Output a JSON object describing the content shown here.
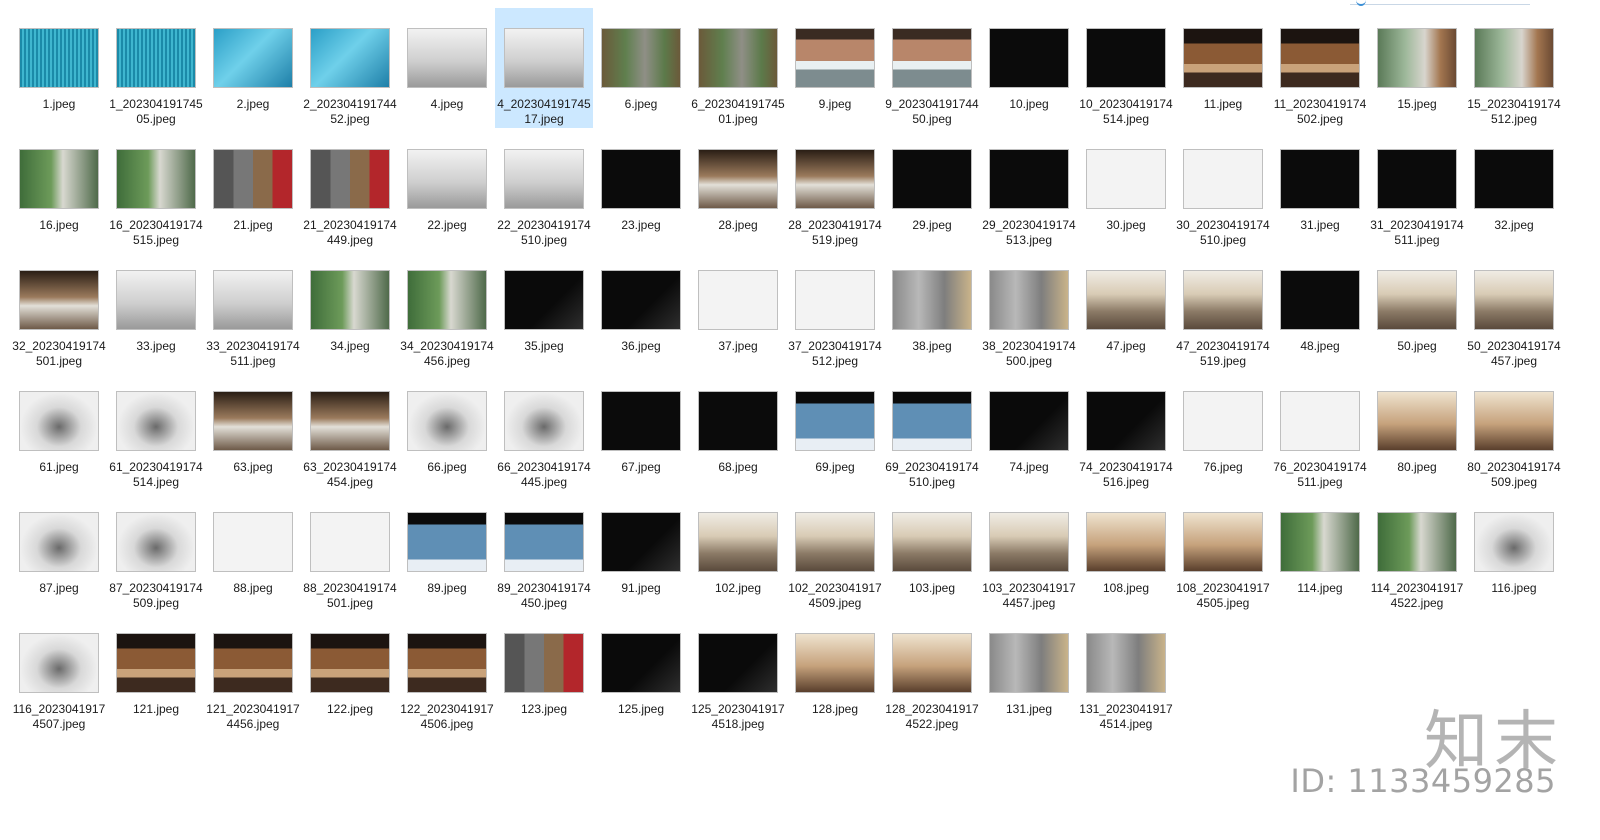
{
  "watermark": {
    "logo_text": "知末",
    "id_text": "ID: 1133459285"
  },
  "items": [
    {
      "label": "1.jpeg",
      "style": "t-teal"
    },
    {
      "label": "1_20230419174505.jpeg",
      "style": "t-teal"
    },
    {
      "label": "2.jpeg",
      "style": "t-teal2"
    },
    {
      "label": "2_20230419174452.jpeg",
      "style": "t-teal2"
    },
    {
      "label": "4.jpeg",
      "style": "t-gray"
    },
    {
      "label": "4_20230419174517.jpeg",
      "style": "t-gray",
      "selected": true
    },
    {
      "label": "6.jpeg",
      "style": "t-plan"
    },
    {
      "label": "6_20230419174501.jpeg",
      "style": "t-plan"
    },
    {
      "label": "9.jpeg",
      "style": "t-warm"
    },
    {
      "label": "9_20230419174450.jpeg",
      "style": "t-warm"
    },
    {
      "label": "10.jpeg",
      "style": "t-black"
    },
    {
      "label": "10_20230419174514.jpeg",
      "style": "t-black"
    },
    {
      "label": "11.jpeg",
      "style": "t-wood"
    },
    {
      "label": "11_20230419174502.jpeg",
      "style": "t-wood"
    },
    {
      "label": "15.jpeg",
      "style": "t-glass"
    },
    {
      "label": "15_20230419174512.jpeg",
      "style": "t-glass"
    },
    {
      "label": "16.jpeg",
      "style": "t-green"
    },
    {
      "label": "16_20230419174515.jpeg",
      "style": "t-green"
    },
    {
      "label": "21.jpeg",
      "style": "t-mat"
    },
    {
      "label": "21_20230419174449.jpeg",
      "style": "t-mat"
    },
    {
      "label": "22.jpeg",
      "style": "t-gray"
    },
    {
      "label": "22_20230419174510.jpeg",
      "style": "t-gray"
    },
    {
      "label": "23.jpeg",
      "style": "t-black"
    },
    {
      "label": "28.jpeg",
      "style": "t-retail"
    },
    {
      "label": "28_20230419174519.jpeg",
      "style": "t-retail"
    },
    {
      "label": "29.jpeg",
      "style": "t-black"
    },
    {
      "label": "29_20230419174513.jpeg",
      "style": "t-black"
    },
    {
      "label": "30.jpeg",
      "style": "t-white"
    },
    {
      "label": "30_20230419174510.jpeg",
      "style": "t-white"
    },
    {
      "label": "31.jpeg",
      "style": "t-black"
    },
    {
      "label": "31_20230419174511.jpeg",
      "style": "t-black"
    },
    {
      "label": "32.jpeg",
      "style": "t-black"
    },
    {
      "label": "32_20230419174501.jpeg",
      "style": "t-retail"
    },
    {
      "label": "33.jpeg",
      "style": "t-gray"
    },
    {
      "label": "33_20230419174511.jpeg",
      "style": "t-gray"
    },
    {
      "label": "34.jpeg",
      "style": "t-green"
    },
    {
      "label": "34_20230419174456.jpeg",
      "style": "t-green"
    },
    {
      "label": "35.jpeg",
      "style": "t-dark2"
    },
    {
      "label": "36.jpeg",
      "style": "t-dark2"
    },
    {
      "label": "37.jpeg",
      "style": "t-white"
    },
    {
      "label": "37_20230419174512.jpeg",
      "style": "t-white"
    },
    {
      "label": "38.jpeg",
      "style": "t-stone"
    },
    {
      "label": "38_20230419174500.jpeg",
      "style": "t-stone"
    },
    {
      "label": "47.jpeg",
      "style": "t-mall"
    },
    {
      "label": "47_20230419174519.jpeg",
      "style": "t-mall"
    },
    {
      "label": "48.jpeg",
      "style": "t-black"
    },
    {
      "label": "50.jpeg",
      "style": "t-mall"
    },
    {
      "label": "50_20230419174457.jpeg",
      "style": "t-mall"
    },
    {
      "label": "61.jpeg",
      "style": "t-atrium"
    },
    {
      "label": "61_20230419174514.jpeg",
      "style": "t-atrium"
    },
    {
      "label": "63.jpeg",
      "style": "t-retail"
    },
    {
      "label": "63_20230419174454.jpeg",
      "style": "t-retail"
    },
    {
      "label": "66.jpeg",
      "style": "t-atrium"
    },
    {
      "label": "66_20230419174445.jpeg",
      "style": "t-atrium"
    },
    {
      "label": "67.jpeg",
      "style": "t-black"
    },
    {
      "label": "68.jpeg",
      "style": "t-black"
    },
    {
      "label": "69.jpeg",
      "style": "t-blue"
    },
    {
      "label": "69_20230419174510.jpeg",
      "style": "t-blue"
    },
    {
      "label": "74.jpeg",
      "style": "t-dark2"
    },
    {
      "label": "74_20230419174516.jpeg",
      "style": "t-dark2"
    },
    {
      "label": "76.jpeg",
      "style": "t-white"
    },
    {
      "label": "76_20230419174511.jpeg",
      "style": "t-white"
    },
    {
      "label": "80.jpeg",
      "style": "t-beige"
    },
    {
      "label": "80_20230419174509.jpeg",
      "style": "t-beige"
    },
    {
      "label": "87.jpeg",
      "style": "t-atrium"
    },
    {
      "label": "87_20230419174509.jpeg",
      "style": "t-atrium"
    },
    {
      "label": "88.jpeg",
      "style": "t-white"
    },
    {
      "label": "88_20230419174501.jpeg",
      "style": "t-white"
    },
    {
      "label": "89.jpeg",
      "style": "t-blue"
    },
    {
      "label": "89_20230419174450.jpeg",
      "style": "t-blue"
    },
    {
      "label": "91.jpeg",
      "style": "t-dark2"
    },
    {
      "label": "102.jpeg",
      "style": "t-mall"
    },
    {
      "label": "102_20230419174509.jpeg",
      "style": "t-mall"
    },
    {
      "label": "103.jpeg",
      "style": "t-mall"
    },
    {
      "label": "103_20230419174457.jpeg",
      "style": "t-mall"
    },
    {
      "label": "108.jpeg",
      "style": "t-beige"
    },
    {
      "label": "108_20230419174505.jpeg",
      "style": "t-beige"
    },
    {
      "label": "114.jpeg",
      "style": "t-green"
    },
    {
      "label": "114_20230419174522.jpeg",
      "style": "t-green"
    },
    {
      "label": "116.jpeg",
      "style": "t-atrium"
    },
    {
      "label": "116_20230419174507.jpeg",
      "style": "t-atrium"
    },
    {
      "label": "121.jpeg",
      "style": "t-wood"
    },
    {
      "label": "121_20230419174456.jpeg",
      "style": "t-wood"
    },
    {
      "label": "122.jpeg",
      "style": "t-wood"
    },
    {
      "label": "122_20230419174506.jpeg",
      "style": "t-wood"
    },
    {
      "label": "123.jpeg",
      "style": "t-mat"
    },
    {
      "label": "125.jpeg",
      "style": "t-dark2"
    },
    {
      "label": "125_20230419174518.jpeg",
      "style": "t-dark2"
    },
    {
      "label": "128.jpeg",
      "style": "t-beige"
    },
    {
      "label": "128_20230419174522.jpeg",
      "style": "t-beige"
    },
    {
      "label": "131.jpeg",
      "style": "t-stone"
    },
    {
      "label": "131_20230419174514.jpeg",
      "style": "t-stone"
    }
  ]
}
